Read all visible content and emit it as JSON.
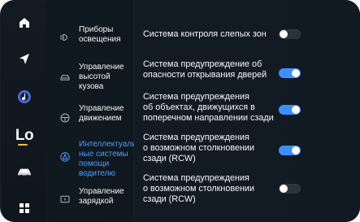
{
  "colors": {
    "background": "#111820",
    "accent": "#3d8fff",
    "active_text": "#4f9eff",
    "text": "#f4f6f8",
    "muted_icon": "#aeb8c4",
    "toggle_off": "#2a333d",
    "lo_indicator": "#f2bf3a"
  },
  "rail": {
    "items": [
      {
        "icon": "home-icon"
      },
      {
        "icon": "navigation-icon"
      },
      {
        "icon": "music-icon"
      },
      {
        "label": "Lo",
        "icon": "lo-indicator"
      },
      {
        "icon": "car-icon"
      },
      {
        "icon": "apps-grid-icon"
      }
    ]
  },
  "submenu": {
    "items": [
      {
        "label": "Приборы\nосвещения",
        "icon": "light-icon",
        "active": false
      },
      {
        "label": "Управление\nвысотой\nкузова",
        "icon": "car-body-icon",
        "active": false
      },
      {
        "label": "Управление\nдвижением",
        "icon": "steering-wheel-icon",
        "active": false
      },
      {
        "label": "Интеллектуаль-\nные системы\nпомощи\nводителю",
        "icon": "driver-assist-icon",
        "active": true
      },
      {
        "label": "Управление\nзарядкой",
        "icon": "charging-icon",
        "active": false
      }
    ]
  },
  "settings": [
    {
      "label": "Система контроля слепых зон",
      "enabled": false
    },
    {
      "label": "Система предупреждение об\nопасности открывания дверей",
      "enabled": true
    },
    {
      "label": "Система предупреждения\nоб объектах, движущихся в\nпоперечном направлении сзади",
      "enabled": true
    },
    {
      "label": "Система предупреждения\nо возможном столкновении\nсзади (RCW)",
      "enabled": true
    },
    {
      "label": "Система предупреждения\nо возможном столкновении\nсзади (RCW)",
      "enabled": false
    }
  ]
}
